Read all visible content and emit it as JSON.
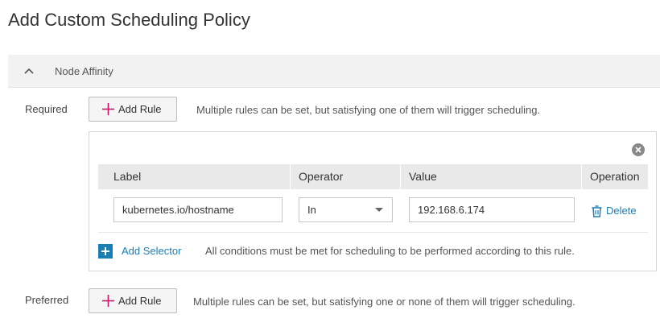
{
  "page": {
    "title": "Add Custom Scheduling Policy"
  },
  "section": {
    "title": "Node Affinity",
    "expanded": true
  },
  "required": {
    "label": "Required",
    "add_rule_label": "Add Rule",
    "hint": "Multiple rules can be set, but satisfying one of them will trigger scheduling."
  },
  "rule": {
    "columns": [
      "Label",
      "Operator",
      "Value",
      "Operation"
    ],
    "rows": [
      {
        "label_value": "kubernetes.io/hostname",
        "operator_value": "In",
        "value_value": "192.168.6.174",
        "operation_label": "Delete"
      }
    ],
    "add_selector_label": "Add Selector",
    "add_selector_hint": "All conditions must be met for scheduling to be performed according to this rule."
  },
  "preferred": {
    "label": "Preferred",
    "add_rule_label": "Add Rule",
    "hint": "Multiple rules can be set, but satisfying one or none of them will trigger scheduling."
  },
  "colors": {
    "accent": "#1a7fb5",
    "plus_icon": "#c7156b",
    "header_bg": "#f2f2f2",
    "table_header_bg": "#e9e9e9"
  },
  "icons": {
    "collapse": "chevron-up-icon",
    "add": "plus-icon",
    "close": "close-circle-icon",
    "dropdown": "caret-down-icon",
    "delete": "trash-icon",
    "add_selector": "plus-square-icon"
  }
}
